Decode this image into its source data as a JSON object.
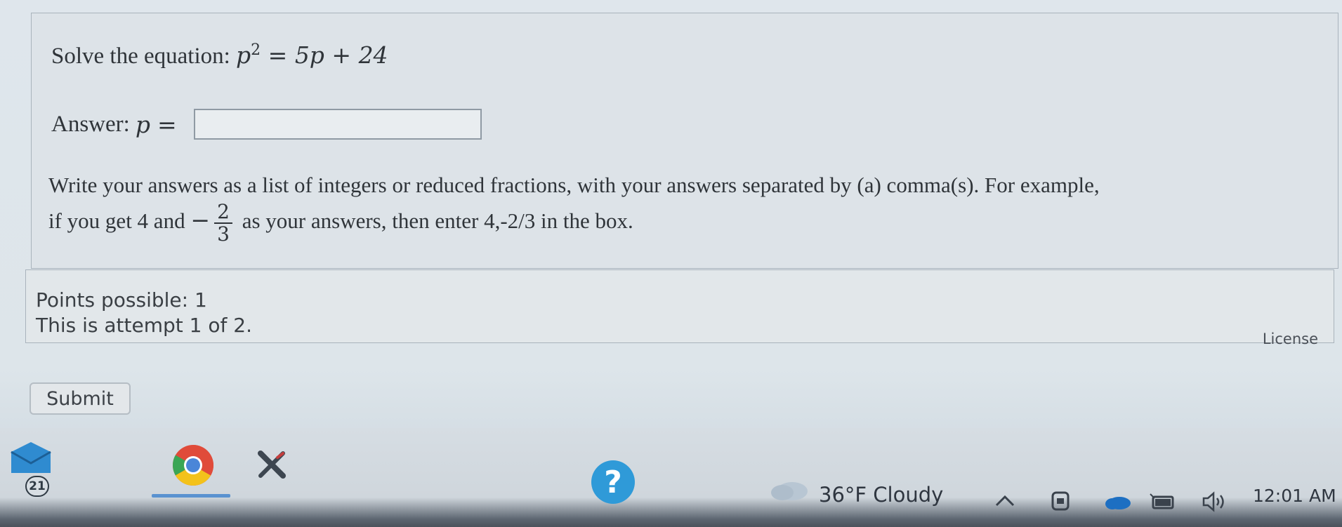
{
  "question": {
    "prompt_text": "Solve the equation: ",
    "equation": {
      "lhs_var": "p",
      "lhs_exp": "2",
      "rhs": "5p + 24"
    },
    "answer_label": "Answer: ",
    "answer_var": "p",
    "answer_eq": "=",
    "answer_value": "",
    "instructions_line1": "Write your answers as a list of integers or reduced fractions, with your answers separated by (a) comma(s). For example,",
    "instructions_pre_frac": "if you get 4 and ",
    "example_fraction": {
      "sign": "−",
      "numerator": "2",
      "denominator": "3"
    },
    "instructions_post_frac": " as your answers, then enter ",
    "instructions_example": "4,-2/3",
    "instructions_end": " in the box."
  },
  "points": {
    "possible": "Points possible: 1",
    "attempt": "This is attempt 1 of 2.",
    "license_label": "License"
  },
  "actions": {
    "submit_label": "Submit"
  },
  "taskbar": {
    "mail_badge": "21",
    "weather": "36°F  Cloudy",
    "clock": "12:01 AM",
    "icons": [
      "mail-icon",
      "chrome-icon",
      "x-app-icon",
      "help-icon",
      "weather-icon",
      "chevron-up-icon",
      "meet-now-icon",
      "onedrive-icon",
      "battery-icon",
      "speaker-icon"
    ],
    "accent_color": "#2f9ad8"
  }
}
